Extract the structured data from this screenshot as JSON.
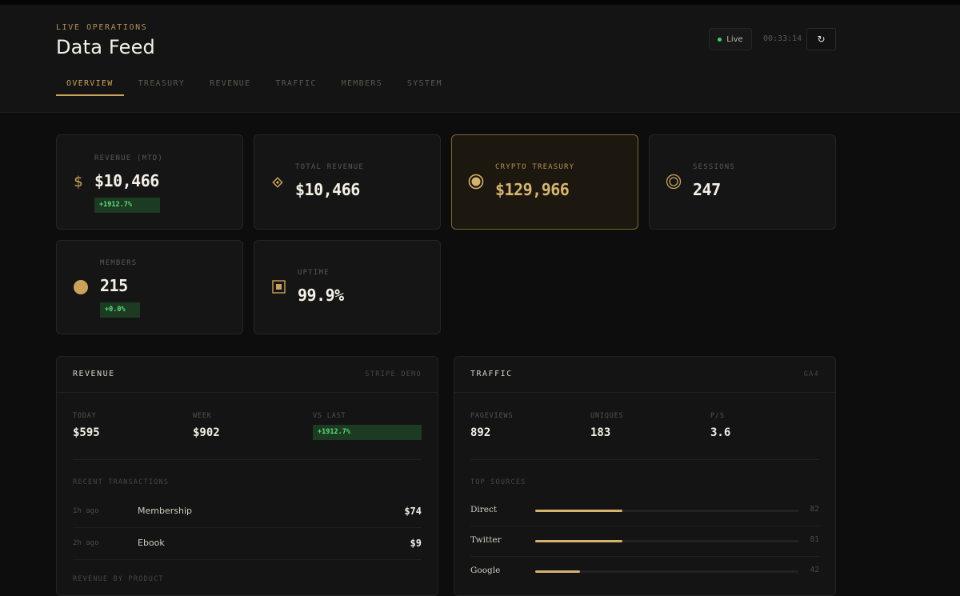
{
  "header": {
    "eyebrow": "LIVE OPERATIONS",
    "title": "Data Feed",
    "live_label": "Live",
    "clock": "00:33:14",
    "refresh_icon": "refresh-icon",
    "tabs": [
      "OVERVIEW",
      "TREASURY",
      "REVENUE",
      "TRAFFIC",
      "MEMBERS",
      "SYSTEM"
    ],
    "active_tab": "OVERVIEW"
  },
  "cards": {
    "revenue_mtd": {
      "label": "REVENUE (MTD)",
      "value": "$10,466",
      "delta": "+1912.7%",
      "icon": "dollar-icon"
    },
    "total_revenue": {
      "label": "TOTAL REVENUE",
      "value": "$10,466",
      "icon": "diamond-icon"
    },
    "crypto_treasury": {
      "label": "CRYPTO TREASURY",
      "value": "$129,966",
      "icon": "coin-icon"
    },
    "sessions": {
      "label": "SESSIONS",
      "value": "247",
      "icon": "target-icon"
    },
    "members": {
      "label": "MEMBERS",
      "value": "215",
      "delta": "+0.0%",
      "icon": "circle-icon"
    },
    "uptime": {
      "label": "UPTIME",
      "value": "99.9%",
      "icon": "square-icon"
    }
  },
  "revenue_panel": {
    "title": "REVENUE",
    "tag": "STRIPE DEMO",
    "stats": [
      {
        "label": "TODAY",
        "value": "$595"
      },
      {
        "label": "WEEK",
        "value": "$902"
      },
      {
        "label": "VS LAST",
        "value": "+1912.7%"
      }
    ],
    "transactions_label": "RECENT TRANSACTIONS",
    "transactions": [
      {
        "time": "1h ago",
        "name": "Membership",
        "amount": "$74"
      },
      {
        "time": "2h ago",
        "name": "Ebook",
        "amount": "$9"
      }
    ],
    "by_product_label": "REVENUE BY PRODUCT"
  },
  "traffic_panel": {
    "title": "TRAFFIC",
    "tag": "GA4",
    "stats": [
      {
        "label": "PAGEVIEWS",
        "value": "892"
      },
      {
        "label": "UNIQUES",
        "value": "183"
      },
      {
        "label": "P/S",
        "value": "3.6"
      }
    ],
    "sources_label": "TOP SOURCES",
    "sources": [
      {
        "name": "Direct",
        "count": "82",
        "share": 0.33
      },
      {
        "name": "Twitter",
        "count": "81",
        "share": 0.33
      },
      {
        "name": "Google",
        "count": "42",
        "share": 0.17
      }
    ]
  },
  "colors": {
    "accent": "#c9a25c",
    "positive": "#59e07a",
    "live": "#3ecf6a"
  }
}
